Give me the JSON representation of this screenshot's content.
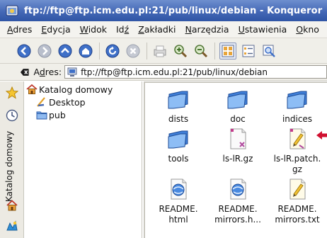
{
  "window": {
    "title": "ftp://ftp@ftp.icm.edu.pl:21/pub/linux/debian - Konqueror"
  },
  "menu": {
    "items": [
      {
        "mnemonic": "A",
        "rest": "dres"
      },
      {
        "mnemonic": "E",
        "rest": "dycja"
      },
      {
        "mnemonic": "W",
        "rest": "idok"
      },
      {
        "pre": "Id",
        "mnemonic": "ź",
        "rest": ""
      },
      {
        "mnemonic": "Z",
        "rest": "akładki"
      },
      {
        "mnemonic": "N",
        "rest": "arzędzia"
      },
      {
        "mnemonic": "U",
        "rest": "stawienia"
      },
      {
        "mnemonic": "O",
        "rest": "kno"
      }
    ]
  },
  "location": {
    "label_pre": "A",
    "label_mn": "d",
    "label_rest": "res:",
    "url": "ftp://ftp@ftp.icm.edu.pl:21/pub/linux/debian"
  },
  "sidebar": {
    "tab_label": "Katalog domowy"
  },
  "tree": {
    "root": "Katalog domowy",
    "children": [
      "Desktop",
      "pub"
    ]
  },
  "files": [
    {
      "name_line1": "dists",
      "name_line2": "",
      "type": "folder"
    },
    {
      "name_line1": "doc",
      "name_line2": "",
      "type": "folder"
    },
    {
      "name_line1": "indices",
      "name_line2": "",
      "type": "folder"
    },
    {
      "name_line1": "tools",
      "name_line2": "",
      "type": "folder"
    },
    {
      "name_line1": "ls-lR.gz",
      "name_line2": "",
      "type": "archive"
    },
    {
      "name_line1": "ls-lR.patch.",
      "name_line2": "gz",
      "type": "text-edit"
    },
    {
      "name_line1": "README.",
      "name_line2": "html",
      "type": "html"
    },
    {
      "name_line1": "README.",
      "name_line2": "mirrors.h...",
      "type": "html"
    },
    {
      "name_line1": "README.",
      "name_line2": "mirrors.txt",
      "type": "text-edit"
    }
  ],
  "colors": {
    "titlebar": "#4468b6",
    "callout": "#d01030"
  }
}
